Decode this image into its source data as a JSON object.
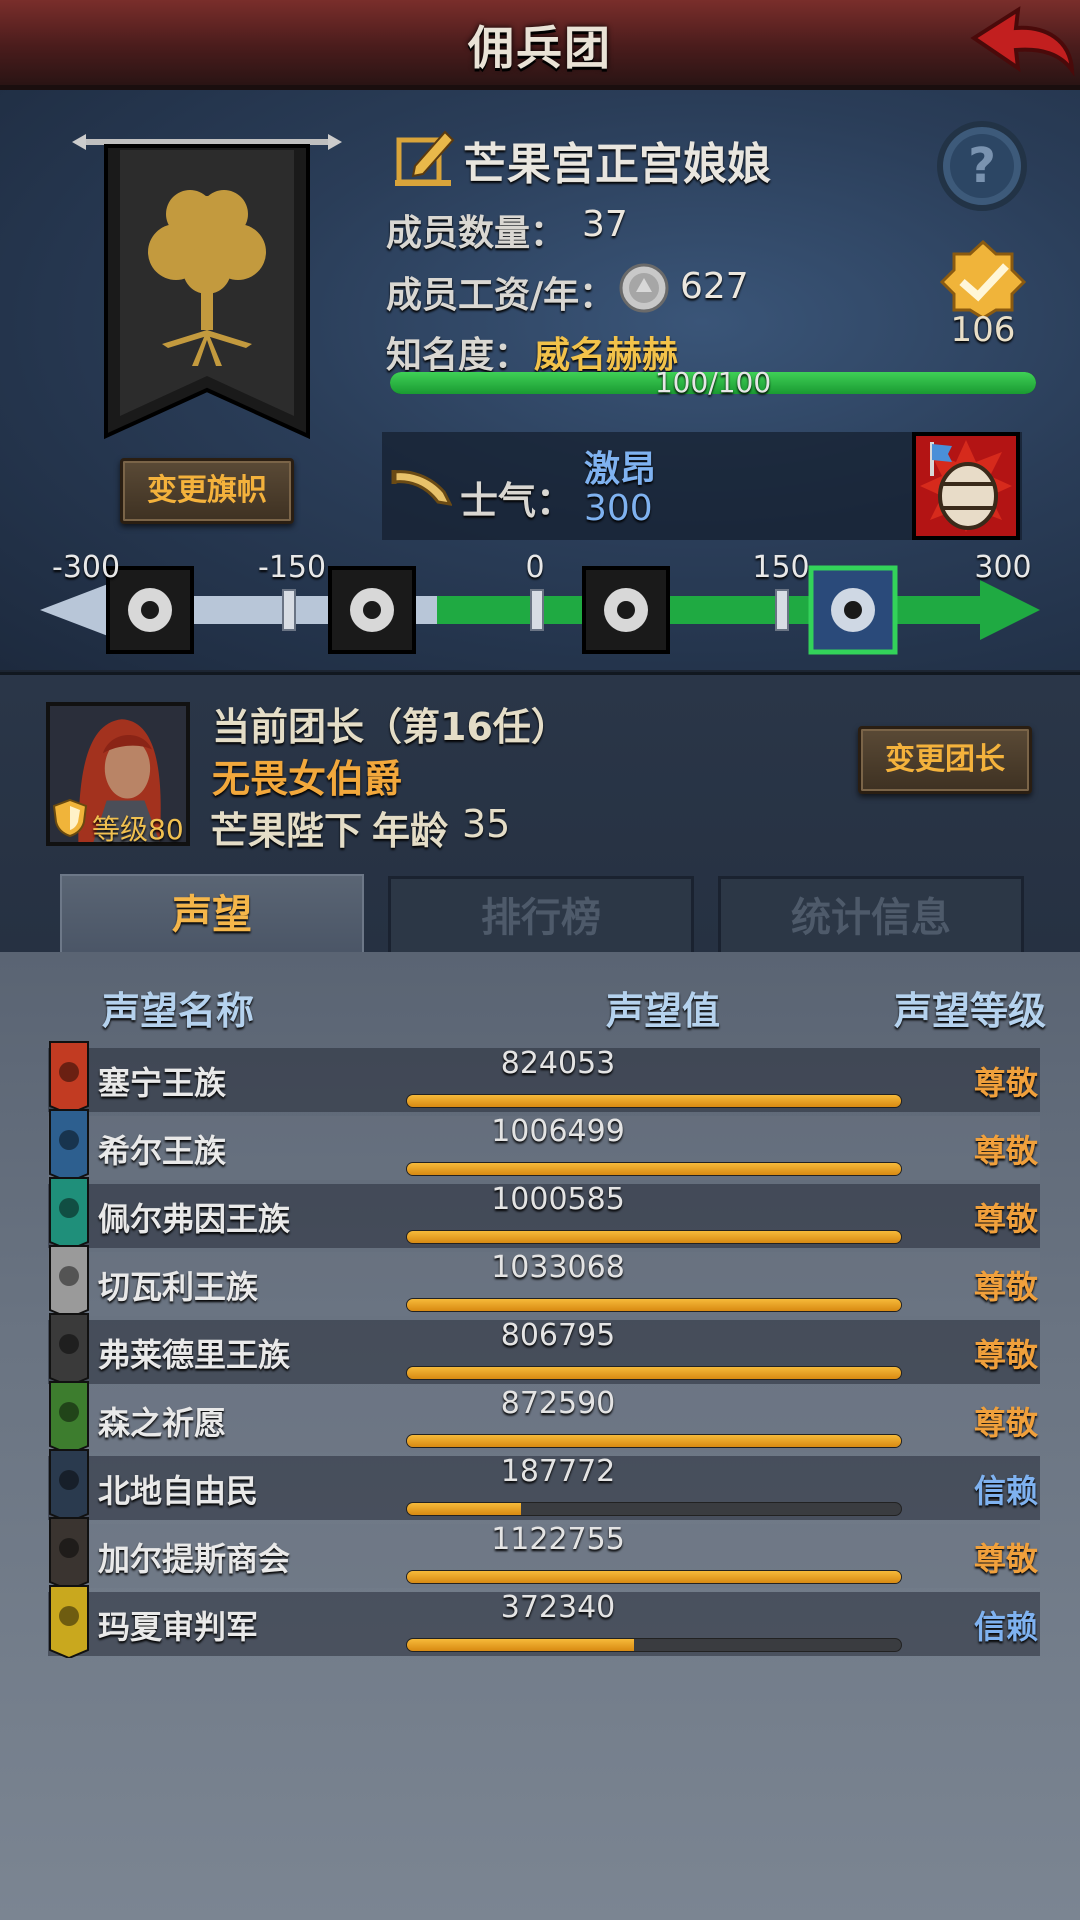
{
  "header": {
    "title": "佣兵团"
  },
  "guild": {
    "name": "芒果宫正宫娘娘",
    "members_label": "成员数量：",
    "members": "37",
    "salary_label": "成员工资/年：",
    "salary": "627",
    "fame_label": "知名度：",
    "fame_title": "威名赫赫",
    "fame_progress": "100/100",
    "fame_ratio": 1.0,
    "rank": "106",
    "change_flag_label": "变更旗帜"
  },
  "morale": {
    "label": "士气：",
    "state": "激昂",
    "value": "300",
    "scale_ticks": [
      "-300",
      "-150",
      "0",
      "150",
      "300"
    ],
    "scale_min": -300,
    "scale_max": 300,
    "current": 300
  },
  "leader": {
    "title": "当前团长（第16任）",
    "name": "无畏女伯爵",
    "subtitle": "芒果陛下",
    "age_label": "年龄",
    "age": "35",
    "level": "等级80",
    "change_leader_label": "变更团长"
  },
  "tabs": [
    "声望",
    "排行榜",
    "统计信息"
  ],
  "table": {
    "headers": [
      "声望名称",
      "声望值",
      "声望等级"
    ],
    "rows": [
      {
        "name": "塞宁王族",
        "value": "824053",
        "fill": 1.0,
        "level": "尊敬",
        "color": "#c23b22",
        "levelColor": "#f0a03c"
      },
      {
        "name": "希尔王族",
        "value": "1006499",
        "fill": 1.0,
        "level": "尊敬",
        "color": "#2d5f8f",
        "levelColor": "#f0a03c"
      },
      {
        "name": "佩尔弗因王族",
        "value": "1000585",
        "fill": 1.0,
        "level": "尊敬",
        "color": "#1f8f7a",
        "levelColor": "#f0a03c"
      },
      {
        "name": "切瓦利王族",
        "value": "1033068",
        "fill": 1.0,
        "level": "尊敬",
        "color": "#9a9a9a",
        "levelColor": "#f0a03c"
      },
      {
        "name": "弗莱德里王族",
        "value": "806795",
        "fill": 1.0,
        "level": "尊敬",
        "color": "#3a3a3a",
        "levelColor": "#f0a03c"
      },
      {
        "name": "森之祈愿",
        "value": "872590",
        "fill": 1.0,
        "level": "尊敬",
        "color": "#3d7d2e",
        "levelColor": "#f0a03c"
      },
      {
        "name": "北地自由民",
        "value": "187772",
        "fill": 0.23,
        "level": "信赖",
        "color": "#2a3a4e",
        "levelColor": "#7fb2f0"
      },
      {
        "name": "加尔提斯商会",
        "value": "1122755",
        "fill": 1.0,
        "level": "尊敬",
        "color": "#3a3430",
        "levelColor": "#f0a03c"
      },
      {
        "name": "玛夏审判军",
        "value": "372340",
        "fill": 0.46,
        "level": "信赖",
        "color": "#c9a81e",
        "levelColor": "#7fb2f0"
      }
    ]
  }
}
